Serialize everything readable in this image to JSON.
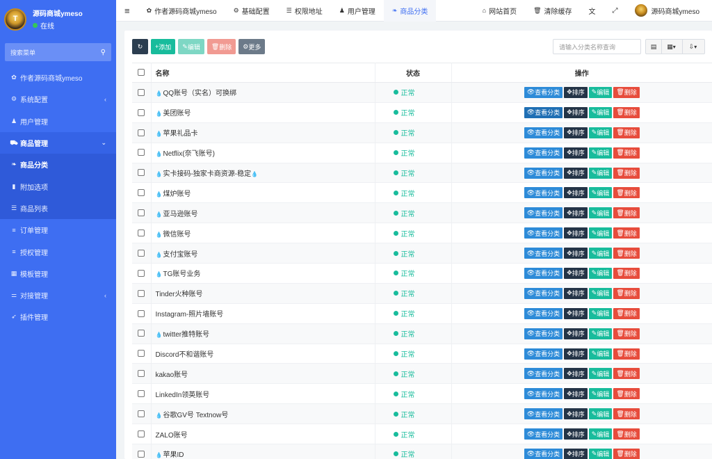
{
  "sidebar": {
    "site_name": "源码商城ymeso",
    "status": "在线",
    "avatar_text": "T",
    "search_label": "搜索菜单",
    "items": [
      {
        "label": "作者源码商城ymeso",
        "icon": "palette-icon"
      },
      {
        "label": "系统配置",
        "icon": "gear-icon",
        "chevron": "‹"
      },
      {
        "label": "用户管理",
        "icon": "user-icon"
      },
      {
        "label": "商品管理",
        "icon": "cart-icon",
        "chevron": "⌄"
      },
      {
        "label": "商品分类",
        "icon": "leaf-icon"
      },
      {
        "label": "附加选项",
        "icon": "bookmark-icon"
      },
      {
        "label": "商品列表",
        "icon": "list-icon"
      },
      {
        "label": "订单管理",
        "icon": "bars-icon"
      },
      {
        "label": "授权管理",
        "icon": "bars-icon"
      },
      {
        "label": "模板管理",
        "icon": "grid-icon"
      },
      {
        "label": "对接管理",
        "icon": "sliders-icon",
        "chevron": "‹"
      },
      {
        "label": "插件管理",
        "icon": "rocket-icon"
      }
    ]
  },
  "topbar": {
    "menu_toggle": "≡",
    "tabs": [
      {
        "label": "作者源码商城ymeso",
        "icon": "palette-icon"
      },
      {
        "label": "基础配置",
        "icon": "gear-icon"
      },
      {
        "label": "权限地址",
        "icon": "list-icon"
      },
      {
        "label": "用户管理",
        "icon": "user-icon"
      },
      {
        "label": "商品分类",
        "icon": "leaf-icon"
      }
    ],
    "home": "网站首页",
    "clear_cache": "清除缓存",
    "username": "源码商城ymeso"
  },
  "toolbar": {
    "add": "添加",
    "edit": "编辑",
    "delete": "删除",
    "more": "更多",
    "search_placeholder": "请输入分类名称查询"
  },
  "table": {
    "headers": {
      "name": "名称",
      "status": "状态",
      "ops": "操作"
    },
    "op_labels": {
      "view": "查看分类",
      "sort": "排序",
      "edit": "编辑",
      "delete": "删除"
    },
    "rows": [
      {
        "name": "QQ账号（实名）可换绑",
        "icon": true,
        "status": "正常"
      },
      {
        "name": "美团账号",
        "icon": true,
        "status": "正常"
      },
      {
        "name": "苹果礼品卡",
        "icon": true,
        "status": "正常"
      },
      {
        "name": "Netflix(奈飞账号)",
        "icon": true,
        "status": "正常"
      },
      {
        "name": "实卡接码-独家卡商资源-稳定",
        "icon": true,
        "icon_after": true,
        "status": "正常"
      },
      {
        "name": "煤炉账号",
        "icon": true,
        "status": "正常"
      },
      {
        "name": "亚马逊账号",
        "icon": true,
        "status": "正常"
      },
      {
        "name": "微信账号",
        "icon": true,
        "status": "正常"
      },
      {
        "name": "支付宝账号",
        "icon": true,
        "status": "正常"
      },
      {
        "name": "TG账号业务",
        "icon": true,
        "status": "正常"
      },
      {
        "name": "Tinder火种账号",
        "icon": false,
        "status": "正常"
      },
      {
        "name": "Instagram-照片墙账号",
        "icon": false,
        "status": "正常"
      },
      {
        "name": "twitter推特账号",
        "icon": true,
        "status": "正常"
      },
      {
        "name": "Discord不和谐账号",
        "icon": false,
        "status": "正常"
      },
      {
        "name": "kakao账号",
        "icon": false,
        "status": "正常"
      },
      {
        "name": "LinkedIn领英账号",
        "icon": false,
        "status": "正常"
      },
      {
        "name": "谷歌GV号 Textnow号",
        "icon": true,
        "status": "正常"
      },
      {
        "name": "ZALO账号",
        "icon": false,
        "status": "正常"
      },
      {
        "name": "苹果ID",
        "icon": true,
        "status": "正常"
      }
    ]
  },
  "colors": {
    "sidebar": "#3e6ef2",
    "accent": "#18bc9c",
    "danger": "#e74c3c",
    "info": "#2d8bd8"
  }
}
